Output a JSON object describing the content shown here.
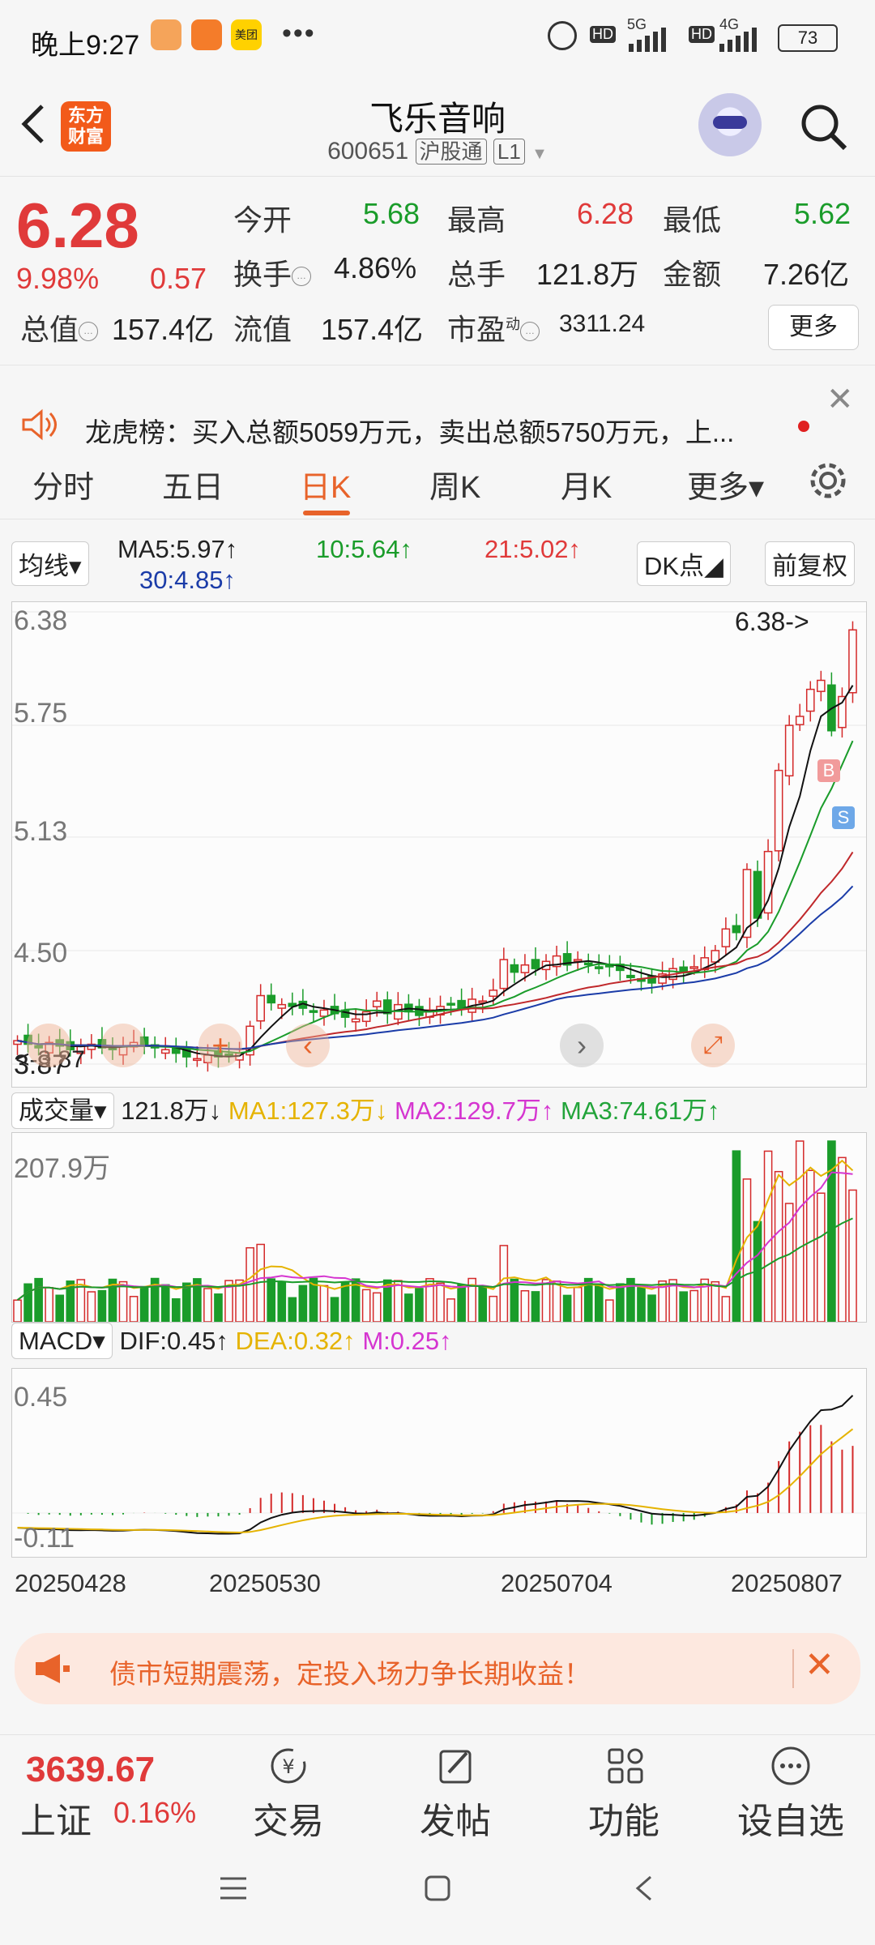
{
  "status_bar": {
    "time": "晚上9:27",
    "dots": "•••",
    "network_1": "5G",
    "network_2": "4G",
    "battery": "73",
    "meituan_label": "美团"
  },
  "header": {
    "app_logo_line1": "东方",
    "app_logo_line2": "财富",
    "stock_name": "飞乐音响",
    "stock_code": "600651",
    "tag_connect": "沪股通",
    "tag_level": "L1"
  },
  "quote": {
    "price": "6.28",
    "change_pct": "9.98%",
    "change": "0.57",
    "open_label": "今开",
    "open": "5.68",
    "high_label": "最高",
    "high": "6.28",
    "low_label": "最低",
    "low": "5.62",
    "turnover_label": "换手",
    "turnover": "4.86%",
    "volume_label": "总手",
    "volume": "121.8万",
    "amount_label": "金额",
    "amount": "7.26亿",
    "mktcap_label": "总值",
    "mktcap": "157.4亿",
    "float_label": "流值",
    "float": "157.4亿",
    "pe_label": "市盈",
    "pe_sup": "动",
    "pe": "3311.24",
    "more_label": "更多"
  },
  "news": {
    "text": "龙虎榜：买入总额5059万元，卖出总额5750万元，上..."
  },
  "tabs": [
    {
      "label": "分时"
    },
    {
      "label": "五日"
    },
    {
      "label": "日K"
    },
    {
      "label": "周K"
    },
    {
      "label": "月K"
    },
    {
      "label": "更多▾"
    }
  ],
  "ma_row": {
    "selector": "均线▾",
    "ma5": "MA5:5.97↑",
    "ma10": "10:5.64↑",
    "ma21": "21:5.02↑",
    "ma30": "30:4.85↑",
    "dk_button": "DK点◢",
    "adjust_button": "前复权"
  },
  "candle_chart": {
    "y_labels": [
      "6.38",
      "5.75",
      "5.13",
      "4.50",
      "3.87"
    ],
    "high_marker": "6.38->",
    "low_marker": "<-3.87",
    "buy_marker": "B",
    "sell_marker": "S"
  },
  "volume_row": {
    "selector": "成交量▾",
    "volume": "121.8万↓",
    "ma1": "MA1:127.3万↓",
    "ma2": "MA2:129.7万↑",
    "ma3": "MA3:74.61万↑",
    "y_max": "207.9万"
  },
  "macd_row": {
    "selector": "MACD▾",
    "dif": "DIF:0.45↑",
    "dea": "DEA:0.32↑",
    "m": "M:0.25↑",
    "y_max": "0.45",
    "y_min": "-0.11"
  },
  "dates": [
    "20250428",
    "20250530",
    "20250704",
    "20250807"
  ],
  "ad": {
    "text": "债市短期震荡，定投入场力争长期收益！"
  },
  "bottom_bar": {
    "index_value": "3639.67",
    "index_name": "上证",
    "index_pct": "0.16%",
    "trade": "交易",
    "post": "发帖",
    "function": "功能",
    "watchlist": "设自选"
  },
  "chart_data": {
    "type": "candlestick",
    "x_start": "20250428",
    "x_end": "20250807",
    "ylim": [
      3.87,
      6.38
    ],
    "close_series": [
      4.0,
      3.98,
      3.96,
      3.99,
      3.97,
      3.95,
      3.97,
      3.98,
      3.96,
      3.95,
      3.97,
      3.99,
      3.98,
      3.96,
      3.95,
      3.93,
      3.91,
      3.9,
      3.92,
      3.91,
      3.92,
      3.93,
      4.08,
      4.25,
      4.21,
      4.2,
      4.19,
      4.18,
      4.16,
      4.17,
      4.15,
      4.13,
      4.12,
      4.16,
      4.22,
      4.15,
      4.2,
      4.16,
      4.14,
      4.17,
      4.19,
      4.2,
      4.18,
      4.23,
      4.22,
      4.28,
      4.45,
      4.38,
      4.42,
      4.4,
      4.44,
      4.47,
      4.42,
      4.45,
      4.43,
      4.4,
      4.41,
      4.39,
      4.35,
      4.33,
      4.32,
      4.37,
      4.4,
      4.38,
      4.41,
      4.46,
      4.5,
      4.62,
      4.6,
      4.95,
      4.68,
      5.05,
      5.5,
      5.75,
      5.8,
      5.95,
      6.0,
      5.72,
      5.91,
      6.28
    ],
    "ma_series": [
      {
        "name": "MA5",
        "last": 5.97
      },
      {
        "name": "MA10",
        "last": 5.64
      },
      {
        "name": "MA21",
        "last": 5.02
      },
      {
        "name": "MA30",
        "last": 4.85
      }
    ]
  }
}
